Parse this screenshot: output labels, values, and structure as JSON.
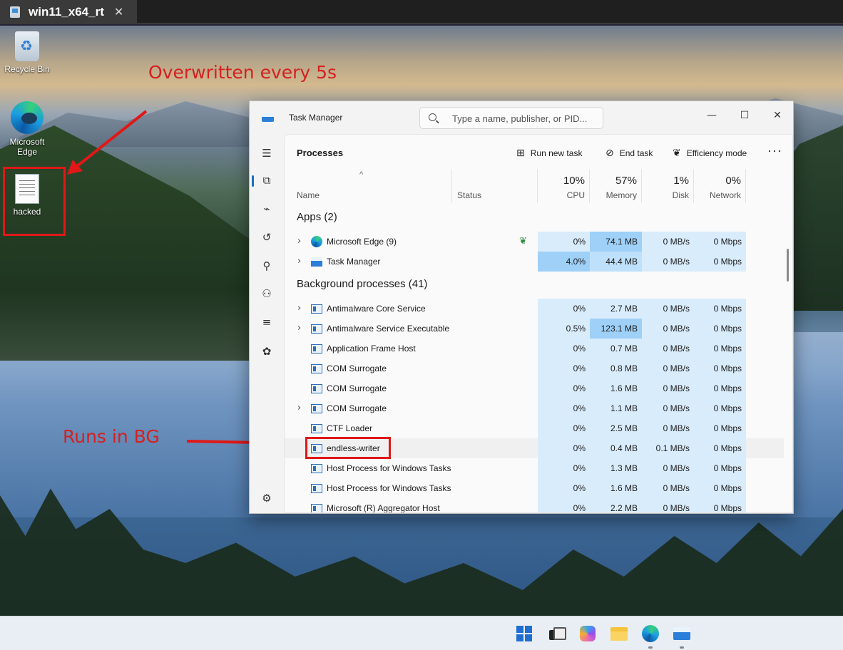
{
  "vm_tab": {
    "title": "win11_x64_rt",
    "close": "✕"
  },
  "desktop": {
    "icons": [
      {
        "label": "Recycle Bin"
      },
      {
        "label": "Microsoft Edge"
      },
      {
        "label": "hacked"
      }
    ]
  },
  "annotations": {
    "top": "Overwritten every 5s",
    "bottom": "Runs in BG",
    "color": "#d42020"
  },
  "task_manager": {
    "title": "Task Manager",
    "search_placeholder": "Type a name, publisher, or PID...",
    "window_controls": {
      "minimize": "—",
      "maximize": "☐",
      "close": "✕"
    },
    "heading": "Processes",
    "toolbar": {
      "run_new_task": "Run new task",
      "end_task": "End task",
      "efficiency_mode": "Efficiency mode",
      "more": "···"
    },
    "columns": {
      "name": "Name",
      "status": "Status",
      "cpu": {
        "pct": "10%",
        "label": "CPU"
      },
      "memory": {
        "pct": "57%",
        "label": "Memory"
      },
      "disk": {
        "pct": "1%",
        "label": "Disk"
      },
      "network": {
        "pct": "0%",
        "label": "Network"
      }
    },
    "sections": {
      "apps": "Apps (2)",
      "background": "Background processes (41)"
    },
    "apps": [
      {
        "name": "Microsoft Edge (9)",
        "cpu": "0%",
        "memory": "74.1 MB",
        "disk": "0 MB/s",
        "network": "0 Mbps"
      },
      {
        "name": "Task Manager",
        "cpu": "4.0%",
        "memory": "44.4 MB",
        "disk": "0 MB/s",
        "network": "0 Mbps"
      }
    ],
    "background": [
      {
        "name": "Antimalware Core Service",
        "cpu": "0%",
        "memory": "2.7 MB",
        "disk": "0 MB/s",
        "network": "0 Mbps"
      },
      {
        "name": "Antimalware Service Executable",
        "cpu": "0.5%",
        "memory": "123.1 MB",
        "disk": "0 MB/s",
        "network": "0 Mbps"
      },
      {
        "name": "Application Frame Host",
        "cpu": "0%",
        "memory": "0.7 MB",
        "disk": "0 MB/s",
        "network": "0 Mbps"
      },
      {
        "name": "COM Surrogate",
        "cpu": "0%",
        "memory": "0.8 MB",
        "disk": "0 MB/s",
        "network": "0 Mbps"
      },
      {
        "name": "COM Surrogate",
        "cpu": "0%",
        "memory": "1.6 MB",
        "disk": "0 MB/s",
        "network": "0 Mbps"
      },
      {
        "name": "COM Surrogate",
        "cpu": "0%",
        "memory": "1.1 MB",
        "disk": "0 MB/s",
        "network": "0 Mbps"
      },
      {
        "name": "CTF Loader",
        "cpu": "0%",
        "memory": "2.5 MB",
        "disk": "0 MB/s",
        "network": "0 Mbps"
      },
      {
        "name": "endless-writer",
        "cpu": "0%",
        "memory": "0.4 MB",
        "disk": "0.1 MB/s",
        "network": "0 Mbps"
      },
      {
        "name": "Host Process for Windows Tasks",
        "cpu": "0%",
        "memory": "1.3 MB",
        "disk": "0 MB/s",
        "network": "0 Mbps"
      },
      {
        "name": "Host Process for Windows Tasks",
        "cpu": "0%",
        "memory": "1.6 MB",
        "disk": "0 MB/s",
        "network": "0 Mbps"
      },
      {
        "name": "Microsoft (R) Aggregator Host",
        "cpu": "0%",
        "memory": "2.2 MB",
        "disk": "0 MB/s",
        "network": "0 Mbps"
      }
    ]
  },
  "taskbar": {
    "apps": [
      "start-icon",
      "task-view-icon",
      "copilot-icon",
      "file-explorer-icon",
      "edge-icon",
      "task-manager-icon"
    ]
  }
}
